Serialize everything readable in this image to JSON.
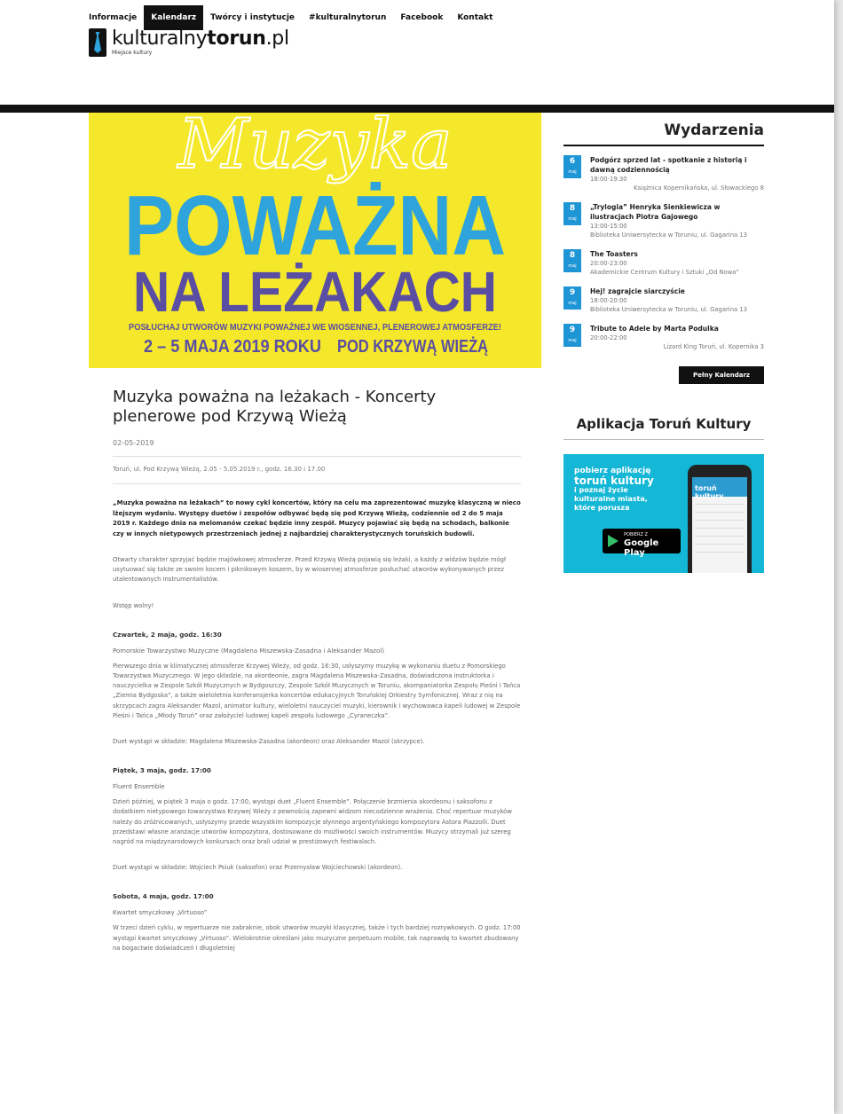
{
  "nav": {
    "items": [
      "Informacje",
      "Kalendarz",
      "Twórcy i instytucje",
      "#kulturalnytorun",
      "Facebook",
      "Kontakt"
    ]
  },
  "logo": {
    "name_prefix": "kulturalny",
    "name_bold": "torun",
    "name_suffix": ".pl",
    "tagline": "Miejsce kultury"
  },
  "hero": {
    "script_text": "Muzyka",
    "line1": "POWAŻNA",
    "line2": "NA LEŻAKACH",
    "tagline": "POSŁUCHAJ UTWORÓW MUZYKI POWAŻNEJ WE WIOSENNEJ, PLENEROWEJ ATMOSFERZE!",
    "dates": "2 – 5 MAJA 2019 ROKU",
    "place": "POD KRZYWĄ WIEŻĄ",
    "colors": {
      "background": "#f5e82a",
      "primary": "#2ea3dc",
      "secondary": "#5a4ea3"
    }
  },
  "article": {
    "title": "Muzyka poważna na leżakach - Koncerty plenerowe pod Krzywą Wieżą",
    "date": "02-05-2019",
    "location": "Toruń, ul. Pod Krzywą Wieżą, 2.05 - 5.05.2019 r., godz. 16.30 i 17.00",
    "lead": "„Muzyka poważna na leżakach” to nowy cykl koncertów, który na celu ma zaprezentować muzykę klasyczną w nieco lżejszym wydaniu. Występy duetów i zespołów odbywać będą się pod Krzywą Wieżą, codziennie od 2 do 5 maja 2019 r. Każdego dnia na melomanów czekać będzie inny zespół. Muzycy pojawiać się będą na schodach, balkonie czy w innych nietypowych przestrzeniach jednej z najbardziej charakterystycznych toruńskich budowli.",
    "p1": "Otwarty charakter sprzyjać będzie majówkowej atmosferze. Przed Krzywą Wieżą pojawią się leżaki, a każdy z widzów będzie mógł usytuować się także ze swoim kocem i piknikowym koszem, by w wiosennej atmosferze posłuchać utworów wykonywanych przez utalentowanych instrumentalistów.",
    "p2": "Wstęp wolny!",
    "day1_head": "Czwartek, 2 maja, godz. 16:30",
    "day1_title": "Pomorskie Towarzystwo Muzyczne (Magdalena Miszewska-Zasadna i Aleksander Mazol)",
    "day1_text": "Pierwszego dnia w klimatycznej atmosferze Krzywej Wieży, od godz. 16:30, usłyszymy muzykę w wykonaniu duetu z Pomorskiego Towarzystwa Muzycznego. W jego składzie, na akordeonie, zagra Magdalena Miszewska-Zasadna, doświadczona instruktorka i nauczycielka w Zespole Szkół Muzycznych w Bydgoszczy, Zespole Szkół Muzycznych w Toruniu, akompaniatorka Zespołu Pieśni i Tańca „Ziemia Bydgoska”, a także wieloletnia konferansjerka koncertów edukacyjnych Toruńskiej Orkiestry Symfonicznej. Wraz z nią na skrzypcach zagra Aleksander Mazol, animator kultury, wieloletni nauczyciel muzyki, kierownik i wychowawca kapeli ludowej w Zespole Pieśni i Tańca „Młody Toruń” oraz założyciel ludowej kapeli zespołu ludowego „Cyraneczka”.",
    "day1_lineup": "Duet wystąpi w składzie: Magdalena Miszewska-Zasadna (akordeon) oraz Aleksander Mazol (skrzypce).",
    "day2_head": "Piątek, 3 maja, godz. 17:00",
    "day2_title": "Fluent Ensemble",
    "day2_text": "Dzień później, w piątek 3 maja o godz. 17:00, wystąpi duet „Fluent Ensemble”. Połączenie brzmienia akordeonu i saksofonu z dodatkiem nietypowego towarzystwa Krzywej Wieży z pewnością zapewni widzom niecodzienne wrażenia. Choć repertuar muzyków należy do zróżnicowanych, usłyszymy przede wszystkim kompozycje słynnego argentyńskiego kompozytora Astora Piazzolli. Duet przedstawi własne aranżacje utworów kompozytora, dostosowane do możliwości swoich instrumentów. Muzycy otrzymali już szereg nagród na międzynarodowych konkursach oraz brali udział w prestiżowych festiwalach.",
    "day2_lineup": "Duet wystąpi w składzie: Wojciech Psiuk (saksofon) oraz Przemysław Wojciechowski (akordeon).",
    "day3_head": "Sobota, 4 maja, godz. 17:00",
    "day3_title": "Kwartet smyczkowy „Virtuoso”",
    "day3_text": "W trzeci dzień cyklu, w repertuarze nie zabraknie, obok utworów muzyki klasycznej, także i tych bardziej rozrywkowych. O godz. 17:00 wystąpi kwartet smyczkowy „Virtuoso”. Wielokrotnie określani jako muzyczne perpetuum mobile, tak naprawdę to kwartet zbudowany na bogactwie doświadczeń i długoletniej"
  },
  "sidebar": {
    "events_heading": "Wydarzenia",
    "events": [
      {
        "day": "6",
        "month": "maj",
        "title": "Podgórz sprzed lat - spotkanie z historią i dawną codziennością",
        "time": "18:00-19:30",
        "place": "Książnica Kopernikańska, ul. Słowackiego 8"
      },
      {
        "day": "8",
        "month": "maj",
        "title": "„Trylogia” Henryka Sienkiewicza w ilustracjach Piotra Gajowego",
        "time": "13:00-15:00",
        "place": "Biblioteka Uniwersytecka w Toruniu, ul. Gagarina 13"
      },
      {
        "day": "8",
        "month": "maj",
        "title": "The Toasters",
        "time": "20:00-23:00",
        "place": "Akademickie Centrum Kultury i Sztuki „Od Nowa”"
      },
      {
        "day": "9",
        "month": "maj",
        "title": "Hej! zagrajcie siarczyście",
        "time": "18:00-20:00",
        "place": "Biblioteka Uniwersytecka w Toruniu, ul. Gagarina 13"
      },
      {
        "day": "9",
        "month": "maj",
        "title": "Tribute to Adele by Marta Podulka",
        "time": "20:00-22:00",
        "place": "Lizard King Toruń, ul. Kopernika 3"
      }
    ],
    "calendar_button": "Pełny Kalendarz",
    "app_heading": "Aplikacja Toruń Kultury",
    "app_banner": {
      "line1": "pobierz aplikację",
      "line2": "toruń kultury",
      "line3": "i poznaj życie",
      "line4": "kulturalne miasta,",
      "line5": "które porusza",
      "store_small": "POBIERZ Z",
      "store_big": "Google Play",
      "phone_header": "toruń kultury"
    }
  }
}
